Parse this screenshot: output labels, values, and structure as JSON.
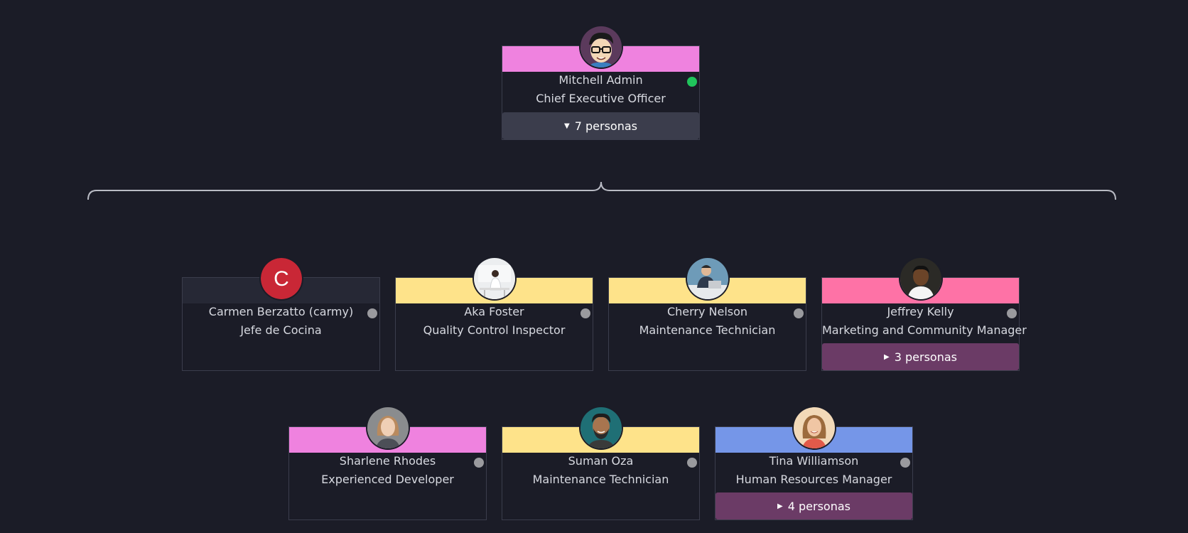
{
  "colors": {
    "background": "#1b1c27",
    "card_border": "#3b3d4c",
    "band_pink": "#ef82df",
    "band_yellow": "#fee38a",
    "band_rose": "#fe72a6",
    "band_blue": "#7596e8",
    "band_dark": "#262835",
    "presence_online": "#20c45b",
    "presence_offline": "#9a9a9e",
    "expand_gray": "#3b3d4c",
    "expand_purple": "#6b3b66",
    "initial_avatar": "#c92736"
  },
  "manager": {
    "name": "Mitchell Admin",
    "job": "Chief Executive Officer",
    "presence": "online",
    "avatar_icon": "cartoon-man-avatar-icon",
    "expand_label": "7 personas",
    "expand_state": "expanded"
  },
  "reports": [
    {
      "name": "Carmen Berzatto (carmy)",
      "job": "Jefe de Cocina",
      "presence": "offline",
      "avatar_initial": "C",
      "avatar_icon": "initial-c-avatar-icon"
    },
    {
      "name": "Aka Foster",
      "job": "Quality Control Inspector",
      "presence": "offline",
      "avatar_icon": "woman-at-desk-avatar-icon"
    },
    {
      "name": "Cherry Nelson",
      "job": "Maintenance Technician",
      "presence": "offline",
      "avatar_icon": "man-at-laptop-avatar-icon"
    },
    {
      "name": "Jeffrey Kelly",
      "job": "Marketing and Community Manager",
      "presence": "offline",
      "avatar_icon": "man-portrait-avatar-icon",
      "expand_label": "3 personas",
      "expand_state": "collapsed"
    },
    {
      "name": "Sharlene Rhodes",
      "job": "Experienced Developer",
      "presence": "offline",
      "avatar_icon": "woman-portrait-avatar-icon"
    },
    {
      "name": "Suman Oza",
      "job": "Maintenance Technician",
      "presence": "offline",
      "avatar_icon": "bearded-man-avatar-icon"
    },
    {
      "name": "Tina Williamson",
      "job": "Human Resources Manager",
      "presence": "offline",
      "avatar_icon": "smiling-woman-avatar-icon",
      "expand_label": "4 personas",
      "expand_state": "collapsed"
    }
  ]
}
